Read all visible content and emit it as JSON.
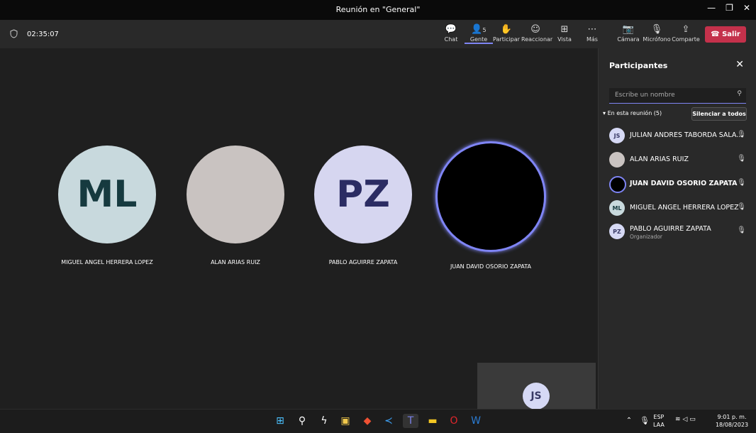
{
  "window": {
    "title": "Reunión en \"General\""
  },
  "toolbar": {
    "timer": "02:35:07",
    "chat": "Chat",
    "people": "Gente",
    "people_count": "5",
    "raise": "Participar",
    "react": "Reaccionar",
    "view": "Vista",
    "more": "Más",
    "camera": "Cámara",
    "mic": "Micrófono",
    "share": "Comparte",
    "leave": "Salir"
  },
  "stage": {
    "tiles": [
      {
        "initials": "ML",
        "name": "MIGUEL ANGEL HERRERA LOPEZ",
        "bg": "#c8d9dd",
        "fg": "#163a3f"
      },
      {
        "initials": "",
        "name": "ALAN ARIAS RUIZ",
        "bg": "#c9c3c1",
        "fg": "#000000"
      },
      {
        "initials": "PZ",
        "name": "PABLO AGUIRRE ZAPATA",
        "bg": "#d6d6f0",
        "fg": "#2b2c63"
      },
      {
        "initials": "",
        "name": "JUAN DAVID OSORIO ZAPATA",
        "bg": "#000000",
        "fg": "#ffffff"
      }
    ],
    "self_initials": "JS"
  },
  "panel": {
    "title": "Participantes",
    "search_placeholder": "Escribe un nombre",
    "section": "En esta reunión (5)",
    "mute_all": "Silenciar a todos",
    "people": [
      {
        "initials": "JS",
        "name": "JULIAN ANDRES TABORDA SALA...",
        "role": "",
        "mic": "muted"
      },
      {
        "initials": "",
        "name": "ALAN ARIAS RUIZ",
        "role": "",
        "mic": "on"
      },
      {
        "initials": "",
        "name": "JUAN DAVID OSORIO ZAPATA",
        "role": "",
        "mic": "on"
      },
      {
        "initials": "ML",
        "name": "MIGUEL ANGEL HERRERA LOPEZ",
        "role": "",
        "mic": "on"
      },
      {
        "initials": "PZ",
        "name": "PABLO AGUIRRE ZAPATA",
        "role": "Organizador",
        "mic": "on"
      }
    ]
  },
  "taskbar": {
    "lang_top": "ESP",
    "lang_bottom": "LAA",
    "time": "9:01 p. m.",
    "date": "18/08/2023"
  },
  "colors": {
    "accent": "#7f85f5",
    "leave": "#c4314b"
  }
}
